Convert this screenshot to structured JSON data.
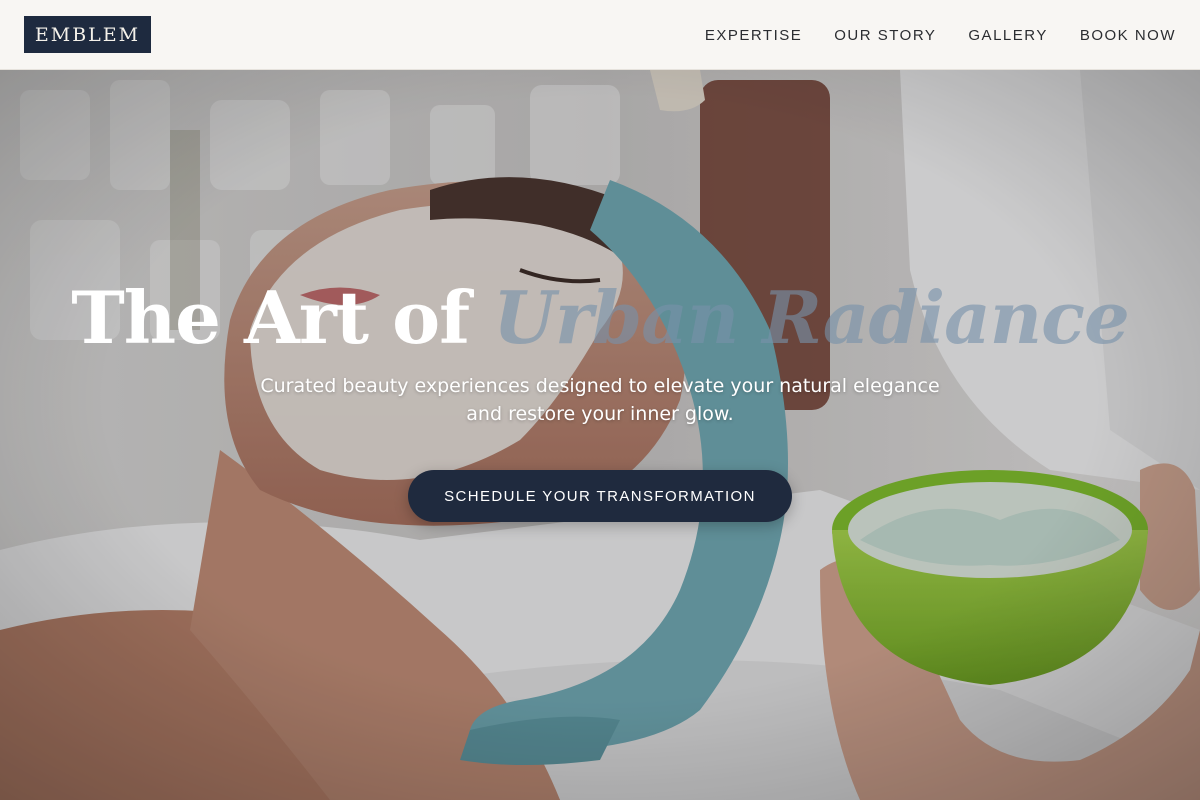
{
  "brand": {
    "logo_text": "EMBLEM"
  },
  "nav": {
    "items": [
      {
        "label": "EXPERTISE"
      },
      {
        "label": "OUR STORY"
      },
      {
        "label": "GALLERY"
      },
      {
        "label": "BOOK NOW"
      }
    ]
  },
  "hero": {
    "headline_main": "The Art of ",
    "headline_accent": "Urban Radiance",
    "subtitle": "Curated beauty experiences designed to elevate your natural elegance and restore your inner glow.",
    "cta_label": "SCHEDULE YOUR TRANSFORMATION",
    "image_subject": "facial-mask-treatment-photo"
  },
  "colors": {
    "navbar_bg": "#f8f6f3",
    "logo_bg": "#1e2a3f",
    "cta_bg": "#1f2a3e",
    "accent_text": "#7891aa"
  }
}
